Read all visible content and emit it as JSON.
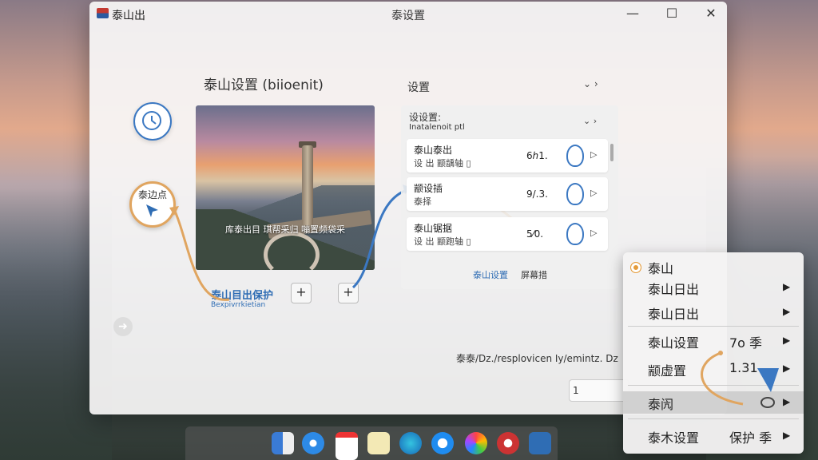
{
  "window": {
    "app_name": "泰山出",
    "title": "泰设置",
    "minimize": "—",
    "maximize": "☐",
    "close": "✕"
  },
  "left": {
    "heading": "泰山设置 (biioenit)",
    "cursor_label": "泰边点",
    "photo_caption": "库泰出目  琪帮采归 嘣置频袋采",
    "under_label": "泰山目出保护",
    "under_sub": "Bexpivrrkietian",
    "plus_1": "+",
    "plus_2": "+",
    "back_arrow": "➜"
  },
  "settings": {
    "header": "设置",
    "header_chevrons": "⌄  ›",
    "panel_title": "设设置:",
    "panel_sub": "Inatalenoit ptl",
    "panel_chevrons": "⌄  ›",
    "cards": [
      {
        "line1": "泰山泰出",
        "line2": "设 出 颛龋轴 ▯",
        "value": "6ℎ1.",
        "tri": "▷"
      },
      {
        "line1": "颛设插",
        "line2": "泰择",
        "value": "9/.3.",
        "tri": "▷"
      },
      {
        "line1": "泰山锯据",
        "line2": "设 出 颛跑轴 ▯",
        "value": "5⁄0.",
        "tri": "▷"
      }
    ],
    "footer_link": "泰山设置",
    "footer_text": "屏幕措"
  },
  "status_text": "泰泰/Dz./resplovicen Iy/emintz. Dz",
  "footer_button": "1 Dquelotrdo",
  "context_menu": {
    "items": [
      {
        "label": "泰山",
        "extra": "",
        "arrow": ""
      },
      {
        "label": "泰山日出",
        "extra": "",
        "arrow": "▶"
      },
      {
        "label": "泰山日出",
        "extra": "",
        "arrow": "▶"
      },
      {
        "label": "泰山设置",
        "extra": "7o 季",
        "arrow": "▶"
      },
      {
        "label": "颛虚置",
        "extra": "1.31",
        "arrow": "▶"
      },
      {
        "label": "泰闶",
        "extra": "",
        "arrow": "▶"
      },
      {
        "label": "泰木设置",
        "extra": "保护 季",
        "arrow": "▶"
      }
    ]
  },
  "colors": {
    "accent_blue": "#3b78c2",
    "accent_orange": "#e0a560"
  },
  "dock": {
    "icons": [
      "finder-icon",
      "safari-icon",
      "calendar-icon",
      "notes-icon",
      "edge-icon",
      "appstore-icon",
      "photos-icon",
      "chrome-icon",
      "calculator-icon"
    ]
  }
}
